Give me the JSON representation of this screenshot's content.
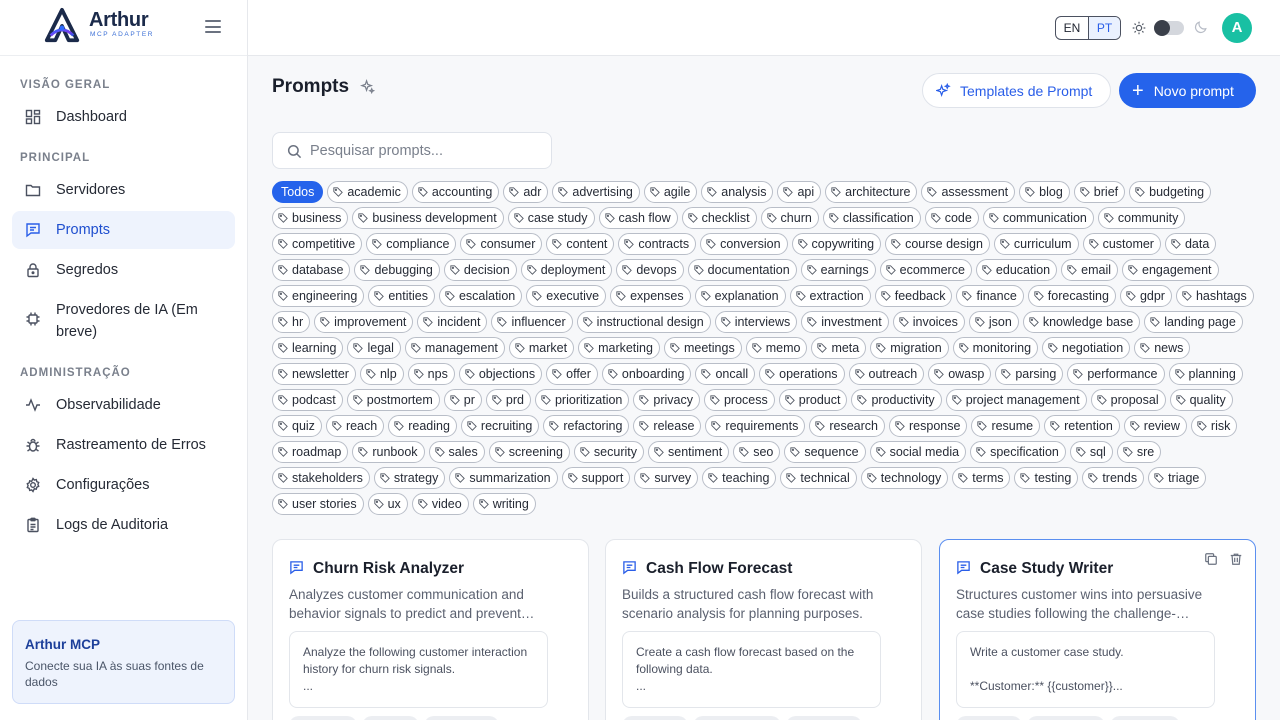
{
  "brand": {
    "name": "Arthur",
    "subtitle": "MCP ADAPTER"
  },
  "sidebar": {
    "sections": [
      {
        "label": "VISÃO GERAL"
      },
      {
        "label": "PRINCIPAL"
      },
      {
        "label": "ADMINISTRAÇÃO"
      }
    ],
    "items": [
      {
        "label": "Dashboard",
        "icon": "dashboard-icon"
      },
      {
        "label": "Servidores",
        "icon": "folder-icon"
      },
      {
        "label": "Prompts",
        "icon": "message-icon",
        "active": true
      },
      {
        "label": "Segredos",
        "icon": "lock-icon"
      },
      {
        "label": "Provedores de IA (Em breve)",
        "icon": "chip-icon"
      },
      {
        "label": "Observabilidade",
        "icon": "activity-icon"
      },
      {
        "label": "Rastreamento de Erros",
        "icon": "bug-icon"
      },
      {
        "label": "Configurações",
        "icon": "gear-icon"
      },
      {
        "label": "Logs de Auditoria",
        "icon": "clipboard-icon"
      }
    ],
    "promo": {
      "title": "Arthur MCP",
      "text": "Conecte sua IA às suas fontes de dados"
    }
  },
  "topbar": {
    "lang_en": "EN",
    "lang_pt": "PT",
    "avatar_initial": "A"
  },
  "main": {
    "title": "Prompts",
    "templates_button": "Templates de Prompt",
    "new_button": "Novo prompt",
    "search_placeholder": "Pesquisar prompts...",
    "all_tag": "Todos",
    "tags": [
      "academic",
      "accounting",
      "adr",
      "advertising",
      "agile",
      "analysis",
      "api",
      "architecture",
      "assessment",
      "blog",
      "brief",
      "budgeting",
      "business",
      "business development",
      "case study",
      "cash flow",
      "checklist",
      "churn",
      "classification",
      "code",
      "communication",
      "community",
      "competitive",
      "compliance",
      "consumer",
      "content",
      "contracts",
      "conversion",
      "copywriting",
      "course design",
      "curriculum",
      "customer",
      "data",
      "database",
      "debugging",
      "decision",
      "deployment",
      "devops",
      "documentation",
      "earnings",
      "ecommerce",
      "education",
      "email",
      "engagement",
      "engineering",
      "entities",
      "escalation",
      "executive",
      "expenses",
      "explanation",
      "extraction",
      "feedback",
      "finance",
      "forecasting",
      "gdpr",
      "hashtags",
      "hr",
      "improvement",
      "incident",
      "influencer",
      "instructional design",
      "interviews",
      "investment",
      "invoices",
      "json",
      "knowledge base",
      "landing page",
      "learning",
      "legal",
      "management",
      "market",
      "marketing",
      "meetings",
      "memo",
      "meta",
      "migration",
      "monitoring",
      "negotiation",
      "news",
      "newsletter",
      "nlp",
      "nps",
      "objections",
      "offer",
      "onboarding",
      "oncall",
      "operations",
      "outreach",
      "owasp",
      "parsing",
      "performance",
      "planning",
      "podcast",
      "postmortem",
      "pr",
      "prd",
      "prioritization",
      "privacy",
      "process",
      "product",
      "productivity",
      "project management",
      "proposal",
      "quality",
      "quiz",
      "reach",
      "reading",
      "recruiting",
      "refactoring",
      "release",
      "requirements",
      "research",
      "response",
      "resume",
      "retention",
      "review",
      "risk",
      "roadmap",
      "runbook",
      "sales",
      "screening",
      "security",
      "sentiment",
      "seo",
      "sequence",
      "social media",
      "specification",
      "sql",
      "sre",
      "stakeholders",
      "strategy",
      "summarization",
      "support",
      "survey",
      "teaching",
      "technical",
      "technology",
      "terms",
      "testing",
      "trends",
      "triage",
      "user stories",
      "ux",
      "video",
      "writing"
    ],
    "cards": [
      {
        "title": "Churn Risk Analyzer",
        "description": "Analyzes customer communication and behavior signals to predict and prevent…",
        "preview": "Analyze the following customer interaction history for churn risk signals.\n..."
      },
      {
        "title": "Cash Flow Forecast",
        "description": "Builds a structured cash flow forecast with scenario analysis for planning purposes.",
        "preview": "Create a cash flow forecast based on the following data.\n..."
      },
      {
        "title": "Case Study Writer",
        "description": "Structures customer wins into persuasive case studies following the challenge-…",
        "preview": "Write a customer case study.\n\n**Customer:** {{customer}}..."
      }
    ]
  }
}
